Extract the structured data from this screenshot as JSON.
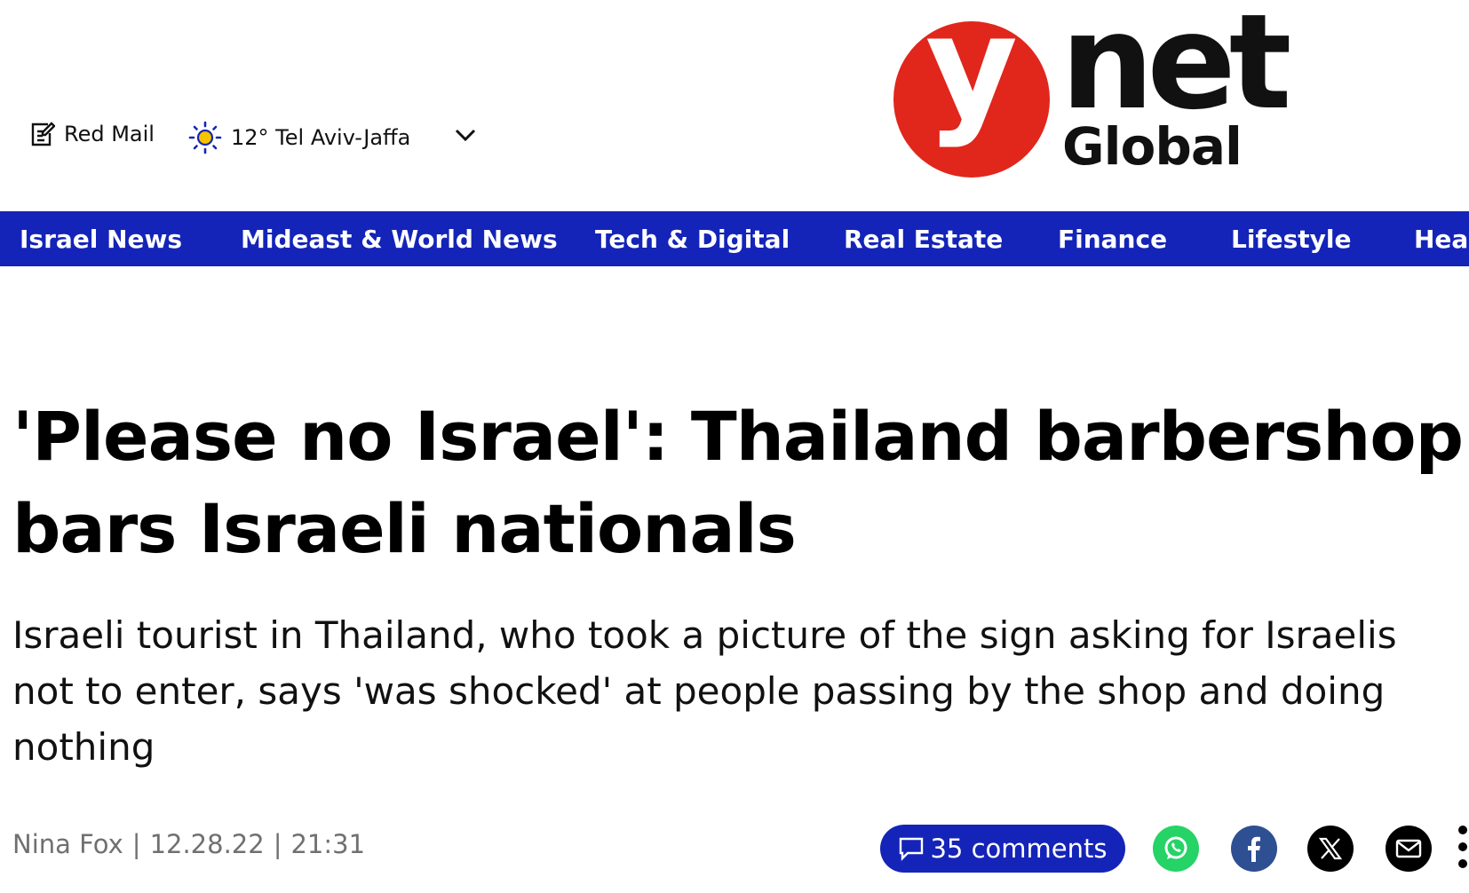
{
  "header": {
    "red_mail_label": "Red Mail",
    "weather_label": "12° Tel Aviv-Jaffa",
    "logo_mark": "y",
    "logo_word": "net",
    "logo_sub": "Global"
  },
  "nav": {
    "items": [
      {
        "label": "Israel News"
      },
      {
        "label": "Mideast & World News"
      },
      {
        "label": "Tech & Digital"
      },
      {
        "label": "Real Estate"
      },
      {
        "label": "Finance"
      },
      {
        "label": "Lifestyle"
      },
      {
        "label": "Heal"
      }
    ]
  },
  "article": {
    "headline_line1": "'Please no Israel': Thailand barbershop",
    "headline_line2": "bars Israeli nationals",
    "subhead": "Israeli tourist in Thailand, who took a picture of the sign asking for Israelis not to enter, says 'was shocked' at people passing by the shop and doing nothing",
    "author": "Nina Fox",
    "date": "12.28.22",
    "time": "21:31",
    "separator": "|",
    "comments_label": "35 comments"
  },
  "colors": {
    "brand_red": "#e1261c",
    "nav_blue": "#1424b8",
    "whatsapp": "#25d366",
    "facebook": "#2e4f92"
  },
  "icons": {
    "mail": "edit-icon",
    "weather": "sun-icon",
    "dropdown": "chevron-down-icon",
    "comments": "comment-icon",
    "share": [
      "whatsapp-icon",
      "facebook-icon",
      "x-icon",
      "email-icon"
    ],
    "more": "more-icon"
  }
}
